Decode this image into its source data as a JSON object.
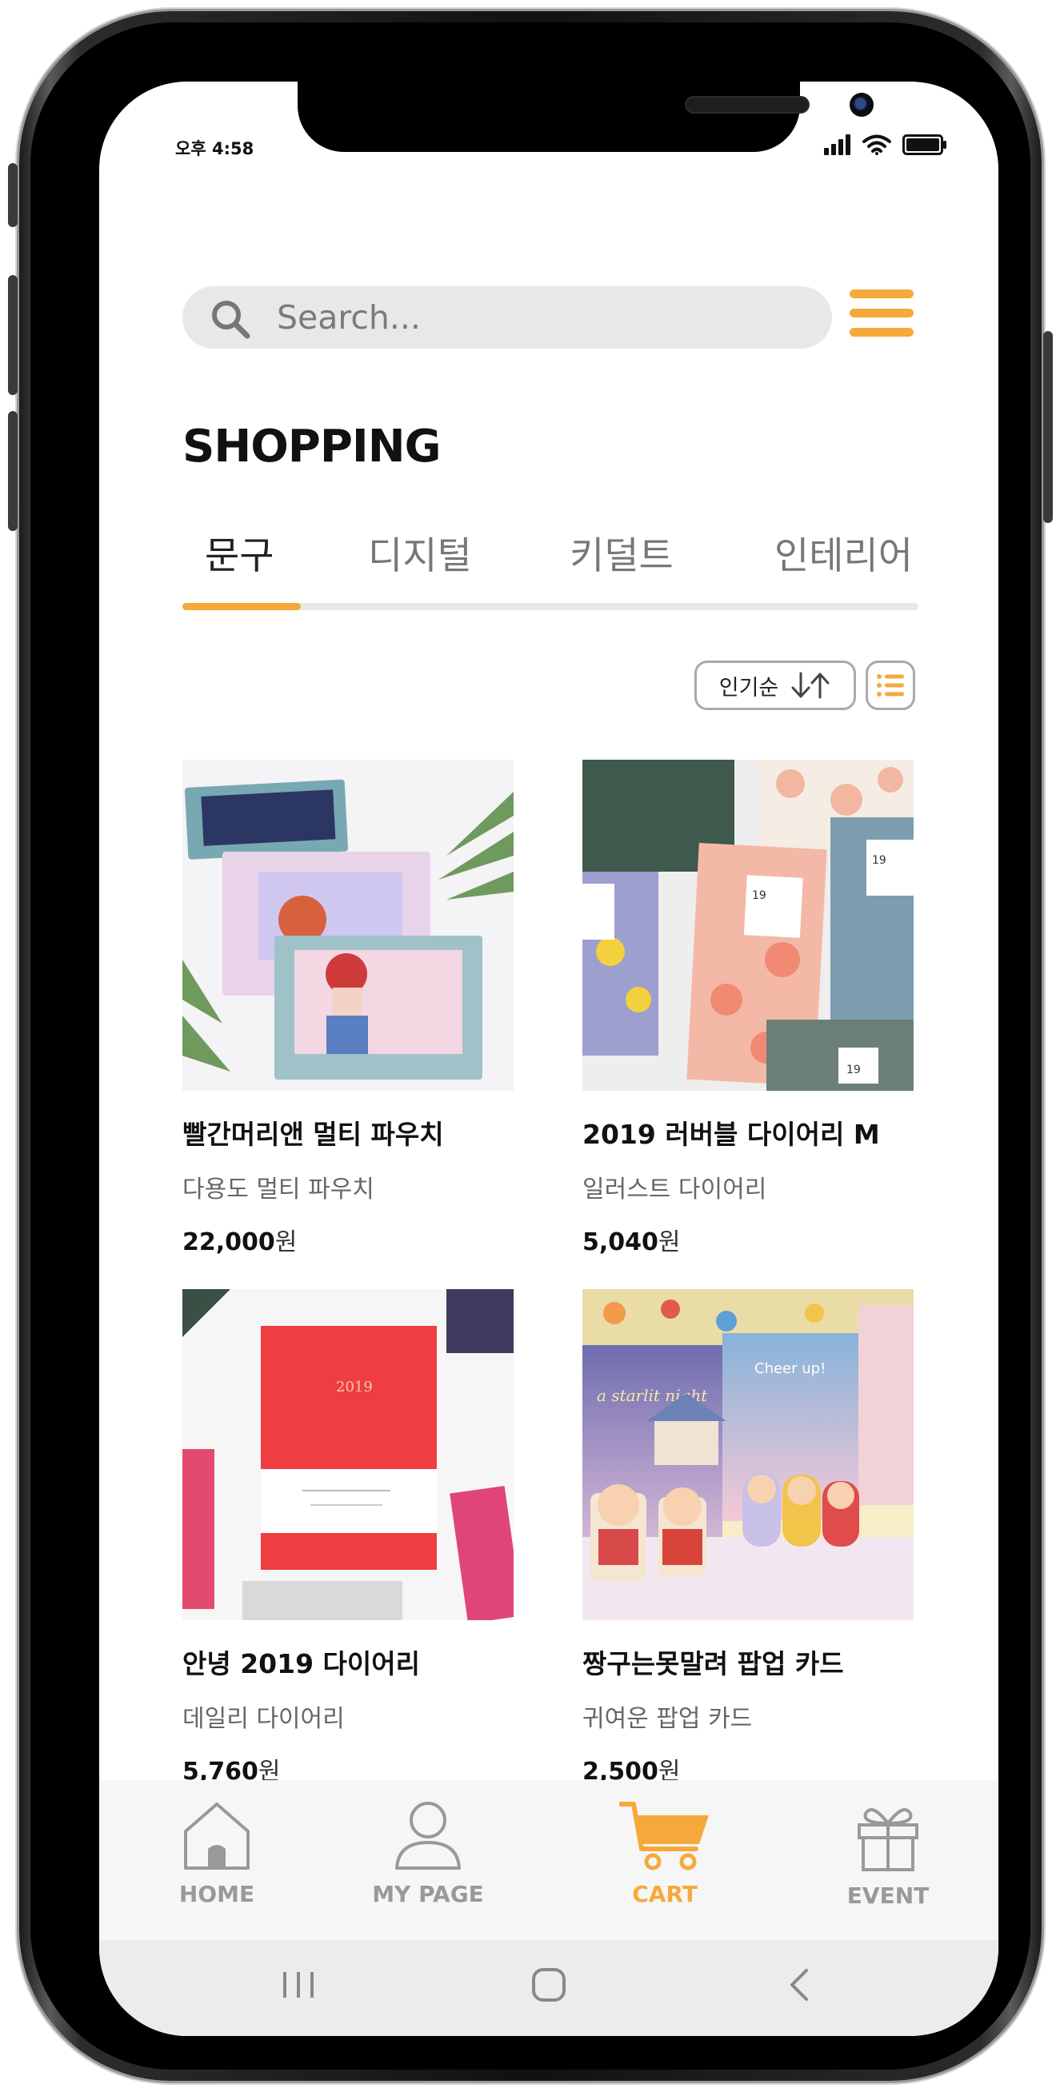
{
  "status_bar": {
    "time": "오후 4:58"
  },
  "search": {
    "placeholder": "Search..."
  },
  "page": {
    "title": "SHOPPING"
  },
  "tabs": [
    {
      "label": "문구",
      "active": true
    },
    {
      "label": "디지털",
      "active": false
    },
    {
      "label": "키덜트",
      "active": false
    },
    {
      "label": "인테리어",
      "active": false
    }
  ],
  "sort": {
    "label": "인기순"
  },
  "products": [
    {
      "name": "빨간머리앤 멀티 파우치",
      "desc": "다용도 멀티 파우치",
      "price": "22,000",
      "unit": "원"
    },
    {
      "name": "2019 러버블 다이어리 M",
      "desc": "일러스트 다이어리",
      "price": "5,040",
      "unit": "원"
    },
    {
      "name": "안녕 2019 다이어리",
      "desc": "데일리 다이어리",
      "price": "5,760",
      "unit": "원"
    },
    {
      "name": "짱구는못말려 팝업 카드",
      "desc": "귀여운 팝업 카드",
      "price": "2,500",
      "unit": "원"
    }
  ],
  "product_images": {
    "diary_cover_text": "2019",
    "diary_page_number": "19",
    "card_text_1": "a starlit night",
    "card_text_2": "Cheer up!"
  },
  "bottom_nav": [
    {
      "label": "HOME",
      "icon": "house-icon",
      "active": false
    },
    {
      "label": "MY PAGE",
      "icon": "person-icon",
      "active": false
    },
    {
      "label": "CART",
      "icon": "cart-icon",
      "active": true
    },
    {
      "label": "EVENT",
      "icon": "gift-icon",
      "active": false
    }
  ],
  "colors": {
    "accent": "#f6a93b",
    "inactive": "#999999",
    "search_bg": "#e8e8e8"
  }
}
